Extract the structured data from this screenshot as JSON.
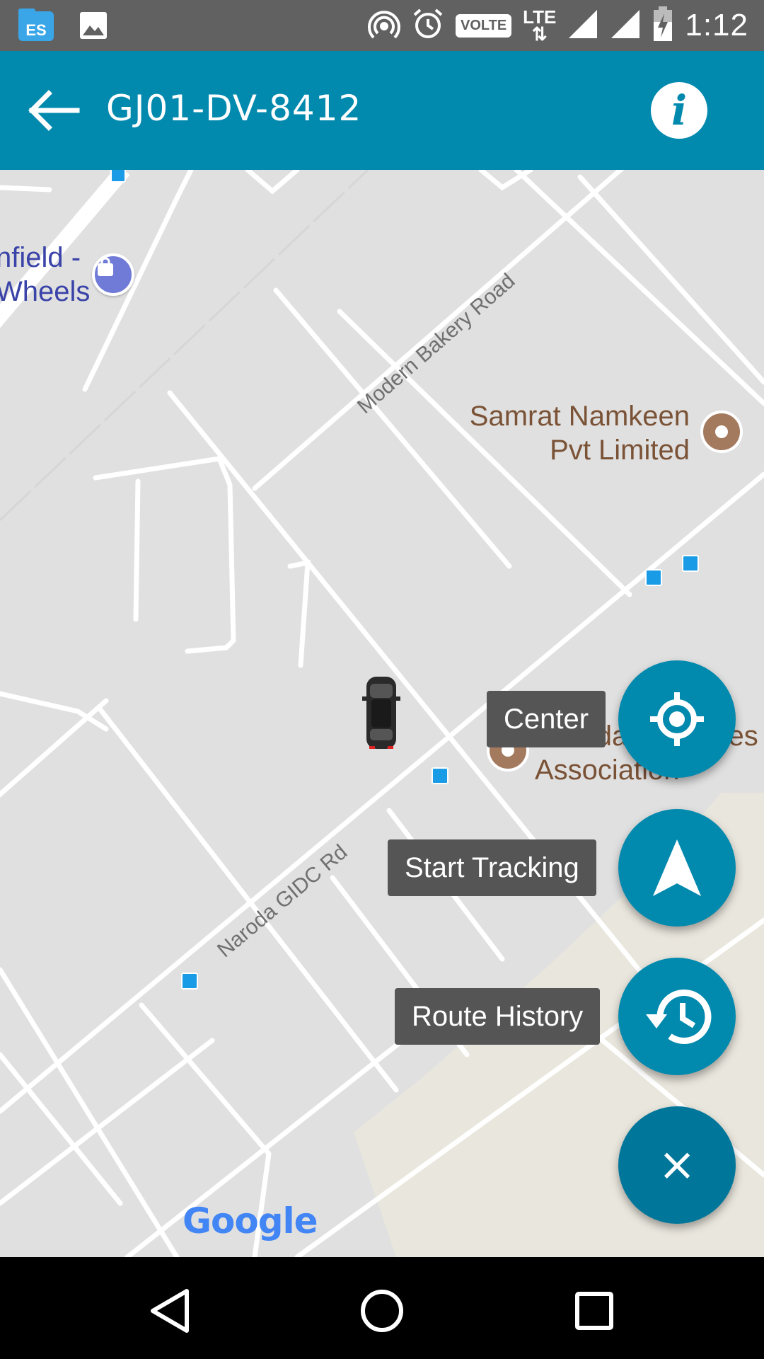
{
  "status_bar": {
    "time": "1:12",
    "volte": "VOLTE",
    "lte": "LTE",
    "icons": [
      "file-manager-icon",
      "gallery-icon",
      "hotspot-icon",
      "alarm-icon",
      "volte-icon",
      "lte-icon",
      "signal-icon",
      "signal-icon",
      "battery-charging-icon"
    ]
  },
  "app_bar": {
    "title": "GJ01-DV-8412",
    "info_glyph": "i",
    "color": "#0289ae"
  },
  "map": {
    "places": {
      "samrat": [
        "Samrat Namkeen",
        "Pvt Limited"
      ],
      "naroda_assoc": [
        "Naroda Industries",
        "Association"
      ],
      "enfield": [
        "nfield -",
        "Wheels"
      ]
    },
    "roads": {
      "modern_bakery": "Modern Bakery Road",
      "naroda_gidc": "Naroda GIDC Rd"
    },
    "attribution": "Google"
  },
  "fab_menu": {
    "center_label": "Center",
    "start_tracking_label": "Start Tracking",
    "route_history_label": "Route History",
    "close_glyph": "×"
  },
  "nav_bar": {
    "icons": [
      "back-triangle-icon",
      "home-circle-icon",
      "recents-square-icon"
    ]
  }
}
